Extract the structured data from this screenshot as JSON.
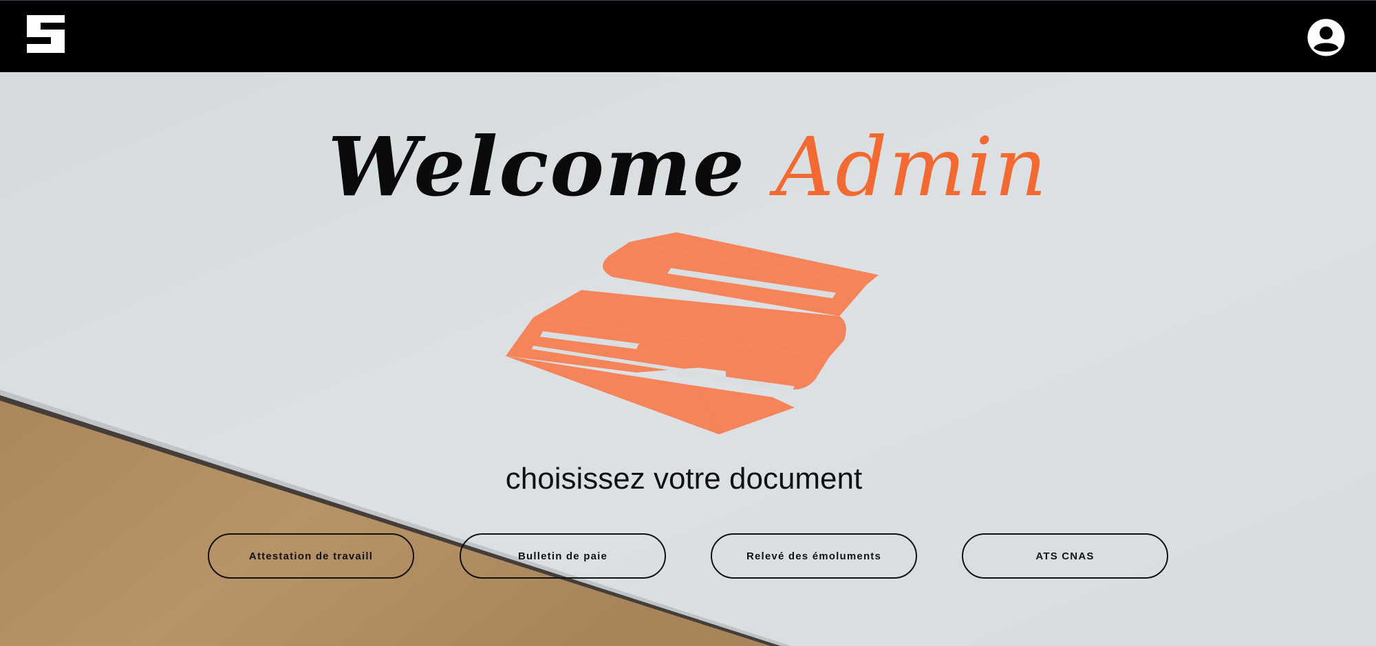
{
  "header": {
    "logo_icon": "company-logo-icon",
    "profile_icon": "account-circle-icon"
  },
  "hero": {
    "welcome_word": "Welcome",
    "welcome_name": "Admin",
    "logo_icon": "company-logo-mark",
    "subtitle": "choisissez votre document"
  },
  "documents": {
    "buttons": [
      {
        "label": "Attestation de travaill"
      },
      {
        "label": "Bulletin de paie"
      },
      {
        "label": "Relevé des émoluments"
      },
      {
        "label": "ATS CNAS"
      }
    ]
  },
  "colors": {
    "header_bg": "#000000",
    "accent": "#f26a32",
    "logo_orange": "#f5845a",
    "paper": "#d9dee1",
    "wood": "#b39063",
    "text": "#111111"
  }
}
